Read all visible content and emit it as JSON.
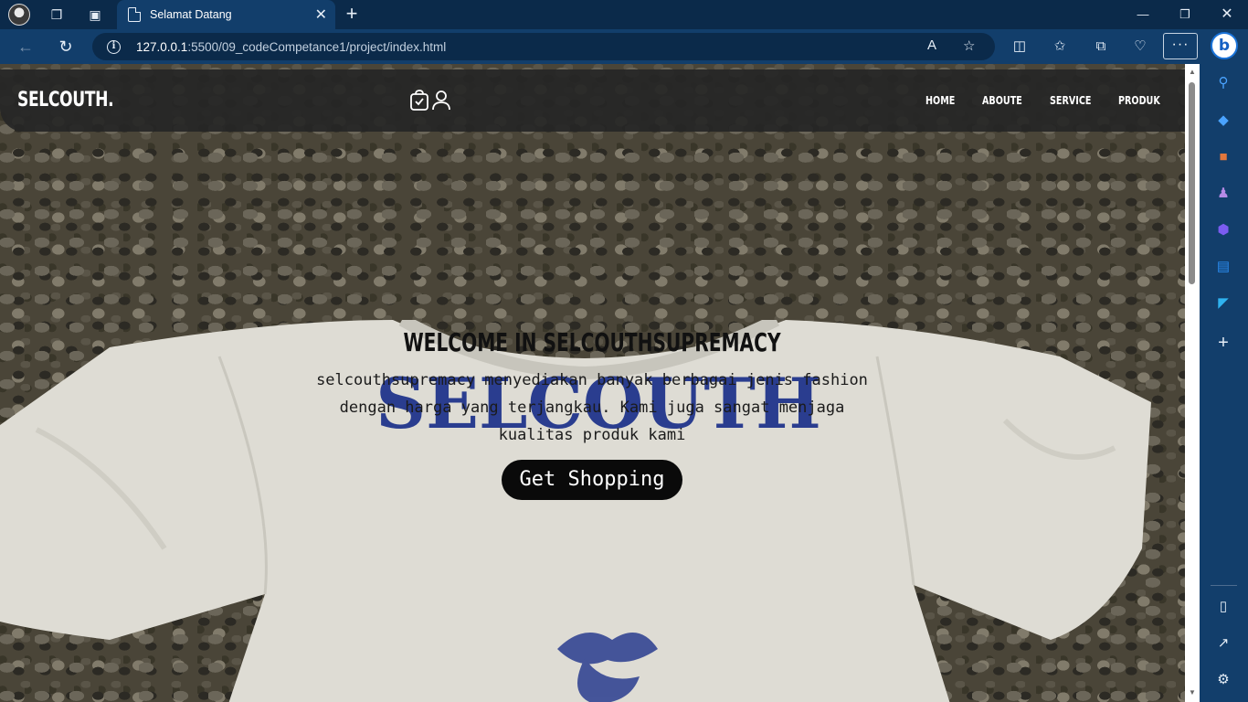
{
  "browser": {
    "tab_title": "Selamat Datang",
    "url_host": "127.0.0.1",
    "url_path": ":5500/09_codeCompetance1/project/index.html",
    "more_label": "···",
    "colors": {
      "frame": "#0b2a4a",
      "toolbar": "#123e6b",
      "accent": "#1a73d9"
    }
  },
  "site": {
    "brand": "SELCOUTH.",
    "nav_links": [
      "HOME",
      "ABOUTE",
      "SERVICE",
      "PRODUK"
    ],
    "hero_title": "WELCOME IN SELCOUTHSUPREMACY",
    "hero_text": "selcouthsupremacy menyediakan banyak berbagai jenis fashion dengan harga yang terjangkau. Kami juga sangat menjaga kualitas produk kami",
    "cta_label": "Get Shopping",
    "shirt_print": "SELCOUTH",
    "colors": {
      "nav_bg": "#262626",
      "cta_bg": "#0a0a0a",
      "print": "#2a3d8f"
    }
  },
  "icons": [
    "cart-icon",
    "user-icon",
    "search-icon",
    "gear-icon"
  ]
}
